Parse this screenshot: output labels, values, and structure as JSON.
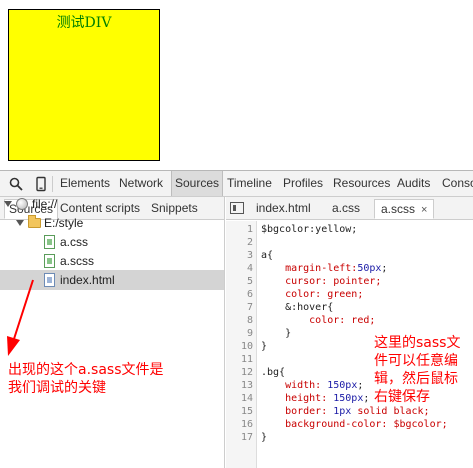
{
  "page": {
    "box_text": "测试DIV",
    "box_color": "#ffff00",
    "box_text_color": "#008000"
  },
  "devtools": {
    "toolbar": {
      "search_icon": "search-icon",
      "device_icon": "device-icon",
      "tabs": [
        "Elements",
        "Network",
        "Sources",
        "Timeline",
        "Profiles",
        "Resources",
        "Audits",
        "Conso"
      ],
      "active_tab": "Sources"
    },
    "navigator": {
      "tabs": [
        "Sources",
        "Content scripts",
        "Snippets"
      ],
      "active_tab": "Sources",
      "tree": [
        {
          "label": "file://",
          "icon": "globe-icon",
          "indent": 0
        },
        {
          "label": "E:/style",
          "icon": "folder-icon",
          "indent": 1
        },
        {
          "label": "a.css",
          "icon": "css-file-icon",
          "indent": 2
        },
        {
          "label": "a.scss",
          "icon": "css-file-icon",
          "indent": 2
        },
        {
          "label": "index.html",
          "icon": "html-file-icon",
          "indent": 2,
          "selected": true
        }
      ]
    },
    "editor": {
      "tabs": [
        "index.html",
        "a.css",
        "a.scss"
      ],
      "active_tab": "a.scss",
      "close_glyph": "×",
      "lines": [
        [
          {
            "t": "$bgcolor:yellow;",
            "c": "sel"
          }
        ],
        [],
        [
          {
            "t": "a{",
            "c": "sel"
          }
        ],
        [
          {
            "t": "    margin-left:",
            "c": "prop"
          },
          {
            "t": "50px",
            "c": "val"
          },
          {
            "t": ";",
            "c": "sel"
          }
        ],
        [
          {
            "t": "    cursor: pointer;",
            "c": "prop"
          }
        ],
        [
          {
            "t": "    color: green;",
            "c": "prop"
          }
        ],
        [
          {
            "t": "    &:hover{",
            "c": "sel"
          }
        ],
        [
          {
            "t": "        color: red;",
            "c": "prop"
          }
        ],
        [
          {
            "t": "    }",
            "c": "sel"
          }
        ],
        [
          {
            "t": "}",
            "c": "sel"
          }
        ],
        [],
        [
          {
            "t": ".bg{",
            "c": "sel"
          }
        ],
        [
          {
            "t": "    width: ",
            "c": "prop"
          },
          {
            "t": "150px",
            "c": "val"
          },
          {
            "t": ";",
            "c": "sel"
          }
        ],
        [
          {
            "t": "    height: ",
            "c": "prop"
          },
          {
            "t": "150px",
            "c": "val"
          },
          {
            "t": ";",
            "c": "sel"
          }
        ],
        [
          {
            "t": "    border: ",
            "c": "prop"
          },
          {
            "t": "1px",
            "c": "val"
          },
          {
            "t": " solid black;",
            "c": "prop"
          }
        ],
        [
          {
            "t": "    background-color: $bgcolor;",
            "c": "prop"
          }
        ],
        [
          {
            "t": "}",
            "c": "sel"
          }
        ]
      ]
    }
  },
  "annotations": {
    "left_note": [
      "出现的这个a.sass文件是",
      "我们调试的关键"
    ],
    "right_note": [
      "这里的sass文",
      "件可以任意编",
      "辑，然后鼠标",
      "右键保存"
    ],
    "color": "#ff0000"
  }
}
